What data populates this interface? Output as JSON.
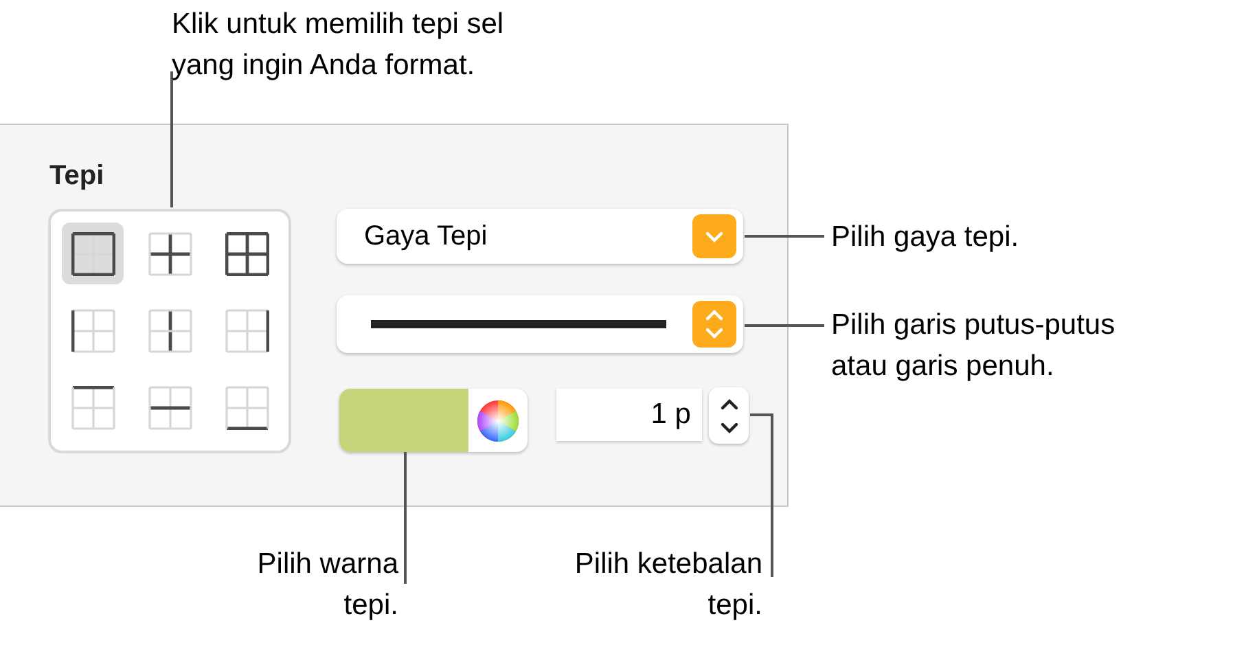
{
  "panel": {
    "title": "Tepi",
    "border_buttons": [
      {
        "kind": "outer",
        "selected": true
      },
      {
        "kind": "inner",
        "selected": false
      },
      {
        "kind": "all",
        "selected": false
      },
      {
        "kind": "left",
        "selected": false
      },
      {
        "kind": "inner-vertical",
        "selected": false
      },
      {
        "kind": "right",
        "selected": false
      },
      {
        "kind": "top",
        "selected": false
      },
      {
        "kind": "inner-horizontal",
        "selected": false
      },
      {
        "kind": "bottom",
        "selected": false
      }
    ],
    "style_popup": {
      "value": "Gaya Tepi"
    },
    "line_popup": {
      "kind": "solid"
    },
    "color_well": {
      "color": "#c5d57a"
    },
    "thickness": {
      "value": "1 p"
    }
  },
  "callouts": [
    {
      "lines": [
        "Klik untuk memilih tepi sel",
        "yang ingin Anda format."
      ]
    },
    {
      "lines": [
        "Pilih gaya tepi."
      ]
    },
    {
      "lines": [
        "Pilih garis putus-putus",
        "atau garis penuh."
      ]
    },
    {
      "lines": [
        "Pilih warna",
        "tepi."
      ]
    },
    {
      "lines": [
        "Pilih ketebalan",
        "tepi."
      ]
    }
  ]
}
